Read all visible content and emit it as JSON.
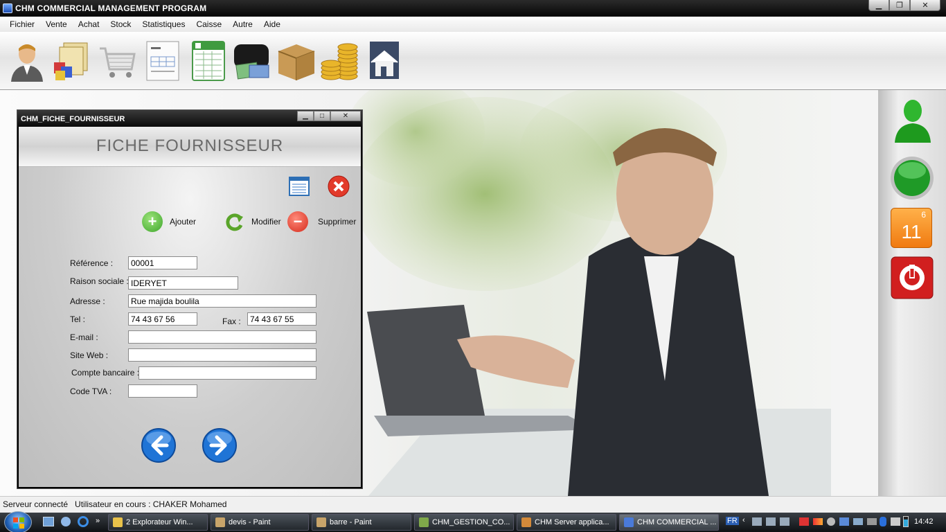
{
  "window": {
    "title": "CHM COMMERCIAL MANAGEMENT PROGRAM"
  },
  "menu": [
    "Fichier",
    "Vente",
    "Achat",
    "Stock",
    "Statistiques",
    "Caisse",
    "Autre",
    "Aide"
  ],
  "toolbar_icons": [
    "user-icon",
    "folders-icon",
    "cart-icon",
    "invoice-icon",
    "spreadsheet-icon",
    "wallet-icon",
    "package-icon",
    "coins-icon",
    "house-icon"
  ],
  "child": {
    "title": "CHM_FICHE_FOURNISSEUR",
    "heading": "FICHE FOURNISSEUR",
    "actions": {
      "add": "Ajouter",
      "edit": "Modifier",
      "delete": "Supprimer"
    },
    "fields": {
      "reference": {
        "label": "Référence :",
        "value": "00001"
      },
      "raison": {
        "label": "Raison sociale :",
        "value": "IDERYET"
      },
      "adresse": {
        "label": "Adresse :",
        "value": "Rue majida boulila"
      },
      "tel": {
        "label": "Tel :",
        "value": "74 43 67 56"
      },
      "fax": {
        "label": "Fax :",
        "value": "74 43 67 55"
      },
      "email": {
        "label": "E-mail :",
        "value": ""
      },
      "siteweb": {
        "label": "Site Web :",
        "value": ""
      },
      "compte": {
        "label": "Compte bancaire :",
        "value": ""
      },
      "tva": {
        "label": "Code TVA :",
        "value": ""
      }
    }
  },
  "sidebar": {
    "calendar_month": "6",
    "calendar_day": "11"
  },
  "status": {
    "text": "Serveur connecté   Utilisateur en cours : CHAKER Mohamed"
  },
  "taskbar": {
    "tasks": [
      "2 Explorateur Win...",
      "devis - Paint",
      "barre - Paint",
      "CHM_GESTION_CO...",
      "CHM Server applica...",
      "CHM COMMERCIAL ..."
    ],
    "lang": "FR",
    "clock": "14:42"
  },
  "colors": {
    "accent_green": "#3fb43f",
    "delete_red": "#e0392b",
    "nav_blue": "#1f74d6"
  }
}
